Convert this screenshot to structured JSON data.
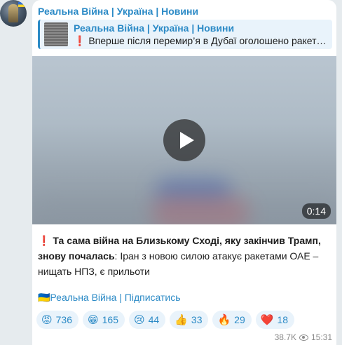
{
  "channel": {
    "name": "Реальна Війна | Україна | Новини"
  },
  "reply": {
    "title": "Реальна Війна | Україна | Новини",
    "text": "❗ Вперше після перемир’я в Дубаї оголошено ракетн…"
  },
  "video": {
    "duration": "0:14"
  },
  "message": {
    "bold": "❗ Та сама війна на Близькому Сході, яку закінчив Трамп, знову почалась",
    "rest": ": Іран з новою силою атакує ракетами ОАЕ – нищать НПЗ, є прильоти"
  },
  "subscribe_link": "🇺🇦Реальна Війна | Підписатись",
  "reactions": [
    {
      "emoji": "😡",
      "count": "736"
    },
    {
      "emoji": "😁",
      "count": "165"
    },
    {
      "emoji": "😢",
      "count": "44"
    },
    {
      "emoji": "👍",
      "count": "33"
    },
    {
      "emoji": "🔥",
      "count": "29"
    },
    {
      "emoji": "❤️",
      "count": "18"
    }
  ],
  "meta": {
    "views": "38.7K",
    "time": "15:31"
  },
  "colors": {
    "accent": "#2b8ac6",
    "background": "#e6ebee",
    "bubble": "#ffffff",
    "reaction_bg": "#e9f3fb"
  }
}
